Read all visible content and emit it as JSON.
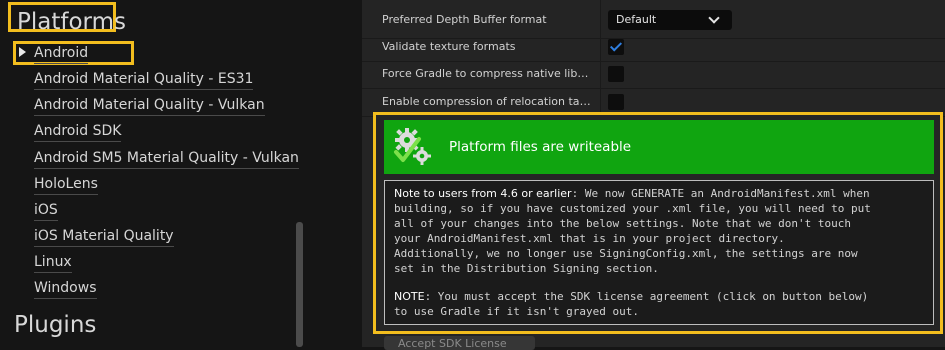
{
  "sidebar": {
    "platforms_title": "Platforms",
    "plugins_title": "Plugins",
    "items": [
      {
        "label": "Android"
      },
      {
        "label": "Android Material Quality - ES31"
      },
      {
        "label": "Android Material Quality - Vulkan"
      },
      {
        "label": "Android SDK"
      },
      {
        "label": "Android SM5 Material Quality - Vulkan"
      },
      {
        "label": "HoloLens"
      },
      {
        "label": "iOS"
      },
      {
        "label": "iOS Material Quality"
      },
      {
        "label": "Linux"
      },
      {
        "label": "Windows"
      }
    ]
  },
  "settings": {
    "depth_buffer": {
      "label": "Preferred Depth Buffer format",
      "value": "Default"
    },
    "validate_textures": {
      "label": "Validate texture formats",
      "checked": true
    },
    "force_gradle": {
      "label": "Force Gradle to compress native libs irrega...",
      "checked": false
    },
    "relocation": {
      "label": "Enable compression of relocation tables (a...",
      "checked": false
    }
  },
  "notice": {
    "status": "Platform files are writeable",
    "status_icon": "gear-check-icon",
    "note_lead": "Note to users from 4.6 or earlier",
    "note_lines": [
      ": We now GENERATE an AndroidManifest.xml when",
      "building, so if you have customized your .xml file, you will need to put",
      "all of your changes into the below settings. Note that we don't touch",
      "your AndroidManifest.xml that is in your project directory.",
      "Additionally, we no longer use SigningConfig.xml, the settings are now",
      "set in the Distribution Signing section."
    ],
    "note2_lead": "NOTE",
    "note2_lines": [
      ": You must accept the SDK license agreement (click on button below)",
      "to use Gradle if it isn't grayed out."
    ]
  },
  "accept_button": "Accept SDK License",
  "colors": {
    "highlight": "#f2bd1e",
    "status_green": "#10a510",
    "check_blue": "#2f7fe0"
  }
}
